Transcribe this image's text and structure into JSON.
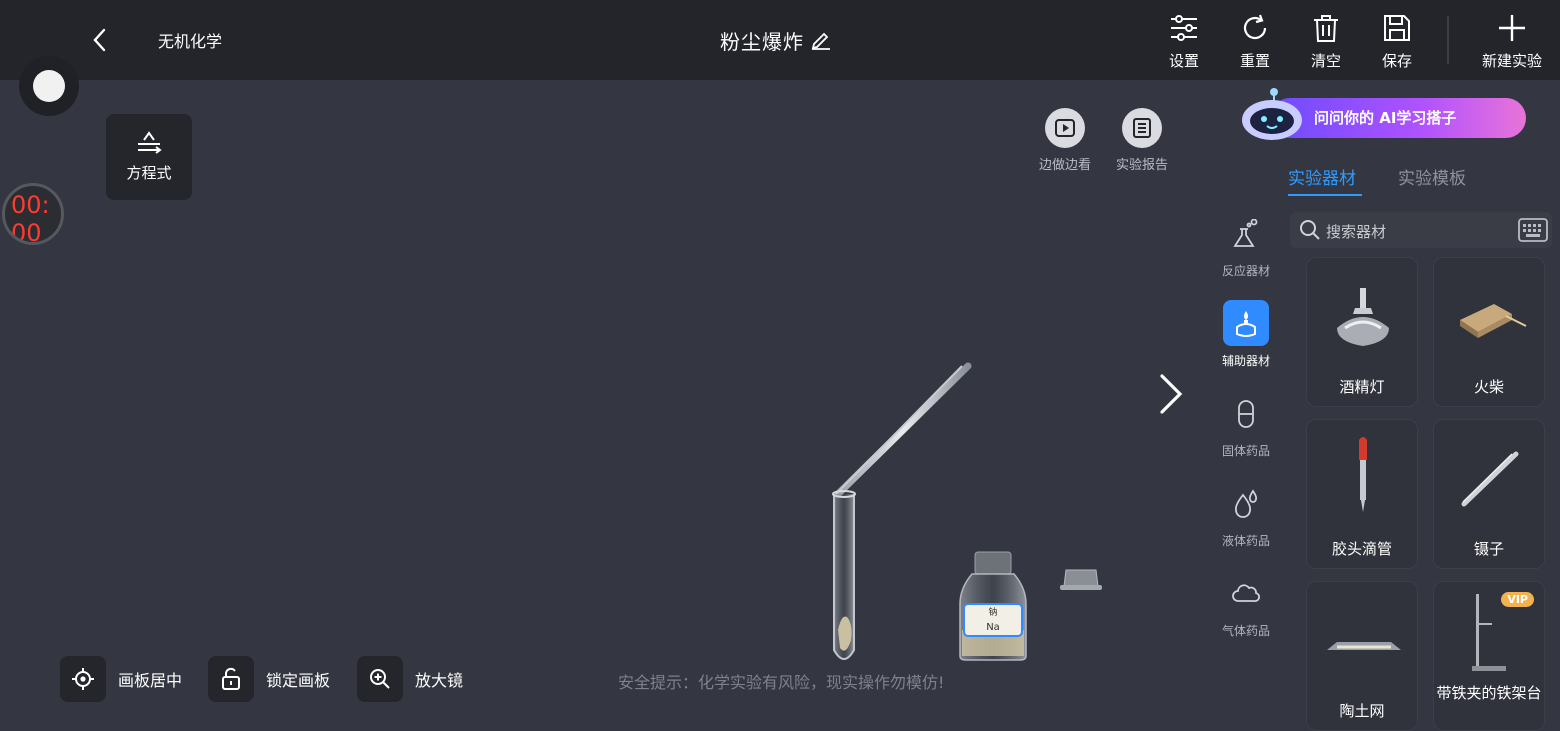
{
  "topbar": {
    "category": "无机化学",
    "title": "粉尘爆炸",
    "tools": [
      {
        "label": "设置",
        "icon": "settings-sliders-icon"
      },
      {
        "label": "重置",
        "icon": "reset-icon"
      },
      {
        "label": "清空",
        "icon": "trash-icon"
      },
      {
        "label": "保存",
        "icon": "save-icon"
      },
      {
        "label": "新建实验",
        "icon": "plus-icon"
      }
    ]
  },
  "left": {
    "timer": "00:00",
    "equation_label": "方程式"
  },
  "canvas_buttons": {
    "watch": "边做边看",
    "report": "实验报告"
  },
  "bottom": {
    "center": "画板居中",
    "lock": "锁定画板",
    "magnifier": "放大镜",
    "safety": "安全提示：化学实验有风险，现实操作勿模仿!"
  },
  "bottle": {
    "cn": "钠",
    "formula": "Na"
  },
  "ai_banner": "问问你的 AI学习搭子",
  "panel": {
    "tabs": [
      "实验器材",
      "实验模板"
    ],
    "search_placeholder": "搜索器材",
    "categories": [
      "反应器材",
      "辅助器材",
      "固体药品",
      "液体药品",
      "气体药品"
    ],
    "active_category": "辅助器材",
    "items": [
      {
        "label": "酒精灯"
      },
      {
        "label": "火柴"
      },
      {
        "label": "胶头滴管"
      },
      {
        "label": "镊子"
      },
      {
        "label": "陶土网"
      },
      {
        "label": "带铁夹的铁架台",
        "badge": "VIP"
      }
    ]
  },
  "colors": {
    "accent": "#2f9bff",
    "timer": "#ff3b30",
    "background": "#343741",
    "topbar": "#23252b"
  }
}
